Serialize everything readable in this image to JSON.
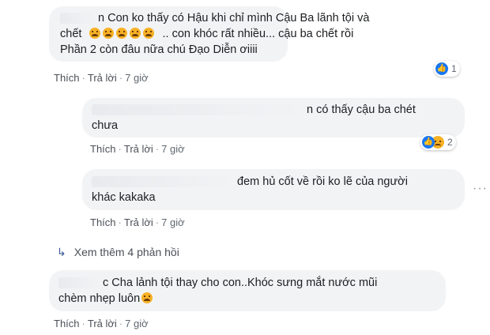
{
  "comments": [
    {
      "lines": [
        "n Con ko thấy có Hậu khi chỉ mình Cậu Ba lãnh tội và",
        "chết",
        ".. con khóc rất nhiều... cậu ba chết rồi",
        "Phần 2 còn đâu nữa chú Đạo Diễn ơiiii"
      ],
      "emoji_count": 5,
      "actions": {
        "like": "Thích",
        "reply": "Trả lời",
        "time": "7 giờ"
      },
      "reaction_count": "1"
    },
    {
      "lines": [
        "n có thấy cậu ba chét",
        "chưa"
      ],
      "actions": {
        "like": "Thích",
        "reply": "Trả lời",
        "time": "7 giờ"
      },
      "reaction_count": "2"
    },
    {
      "lines": [
        "đem hủ cốt về rồi ko lẽ của người",
        "khác kakaka"
      ],
      "actions": {
        "like": "Thích",
        "reply": "Trả lời",
        "time": "7 giờ"
      },
      "more": "···"
    },
    {
      "lines": [
        "c Cha lảnh tội thay cho con..Khóc sưng mắt nước mũi",
        "chèm nhẹp luôn"
      ],
      "actions": {
        "like": "Thích",
        "reply": "Trả lời",
        "time": "7 giờ"
      }
    }
  ],
  "view_more": {
    "arrow": "↳",
    "label": "Xem thêm 4 phản hồi"
  },
  "icons": {
    "like": "like-icon",
    "sad": "sad-icon",
    "crying_emoji": "crying-face-icon"
  },
  "colors": {
    "bubble": "#f2f3f5",
    "like_blue": "#1877f2",
    "text": "#1c1e21",
    "meta": "#606770"
  }
}
